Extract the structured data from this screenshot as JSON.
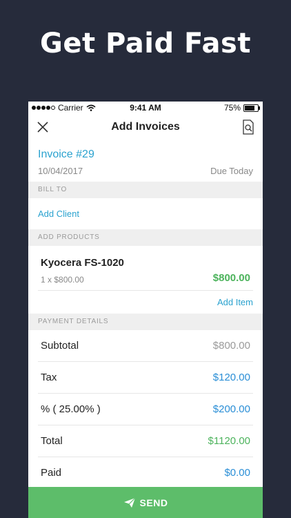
{
  "promo": {
    "headline": "Get Paid Fast"
  },
  "status_bar": {
    "carrier": "Carrier",
    "time": "9:41 AM",
    "battery": "75%",
    "battery_level": 0.75
  },
  "nav": {
    "title": "Add Invoices",
    "close_icon": "close-icon",
    "document_icon": "document-search-icon"
  },
  "invoice": {
    "number": "Invoice #29",
    "date": "10/04/2017",
    "due": "Due Today"
  },
  "bill_to": {
    "header": "BILL TO",
    "add_client": "Add Client"
  },
  "products": {
    "header": "ADD PRODUCTS",
    "items": [
      {
        "name": "Kyocera FS-1020",
        "qty": "1 x $800.00",
        "price": "$800.00"
      }
    ],
    "add_item": "Add Item"
  },
  "payment": {
    "header": "PAYMENT DETAILS",
    "rows": [
      {
        "label": "Subtotal",
        "value": "$800.00",
        "color": "#9a9a9a"
      },
      {
        "label": "Tax",
        "value": "$120.00",
        "color": "#2a8ed6"
      },
      {
        "label": "% ( 25.00% )",
        "value": "$200.00",
        "color": "#2a8ed6"
      },
      {
        "label": "Total",
        "value": "$1120.00",
        "color": "#4cb35c"
      },
      {
        "label": "Paid",
        "value": "$0.00",
        "color": "#2a8ed6"
      }
    ]
  },
  "send": {
    "label": "SEND",
    "icon": "paper-plane-icon"
  },
  "colors": {
    "background": "#262b3b",
    "accent_blue": "#2aa2cf",
    "green": "#5dbd6a"
  }
}
